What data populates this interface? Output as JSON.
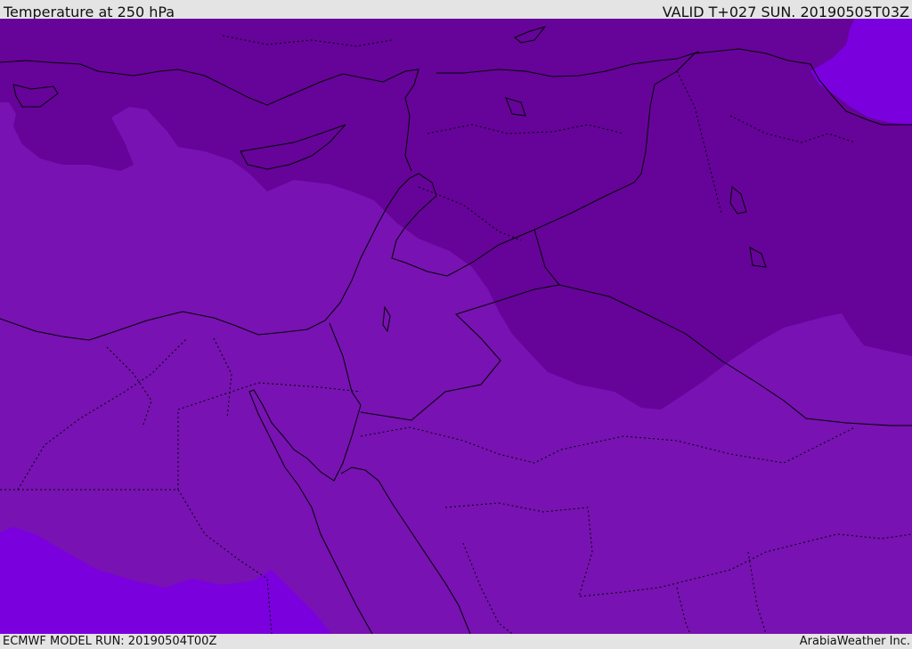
{
  "header": {
    "title": "Temperature at 250 hPa",
    "valid": "VALID T+027 SUN. 20190505T03Z"
  },
  "footer": {
    "model_run": "ECMWF MODEL RUN: 20190504T00Z",
    "credit": "ArabiaWeather Inc."
  },
  "map": {
    "colors": {
      "base": "#7812b2",
      "cold": "#660399",
      "warm": "#7a00de",
      "land_line": "#000000"
    }
  }
}
